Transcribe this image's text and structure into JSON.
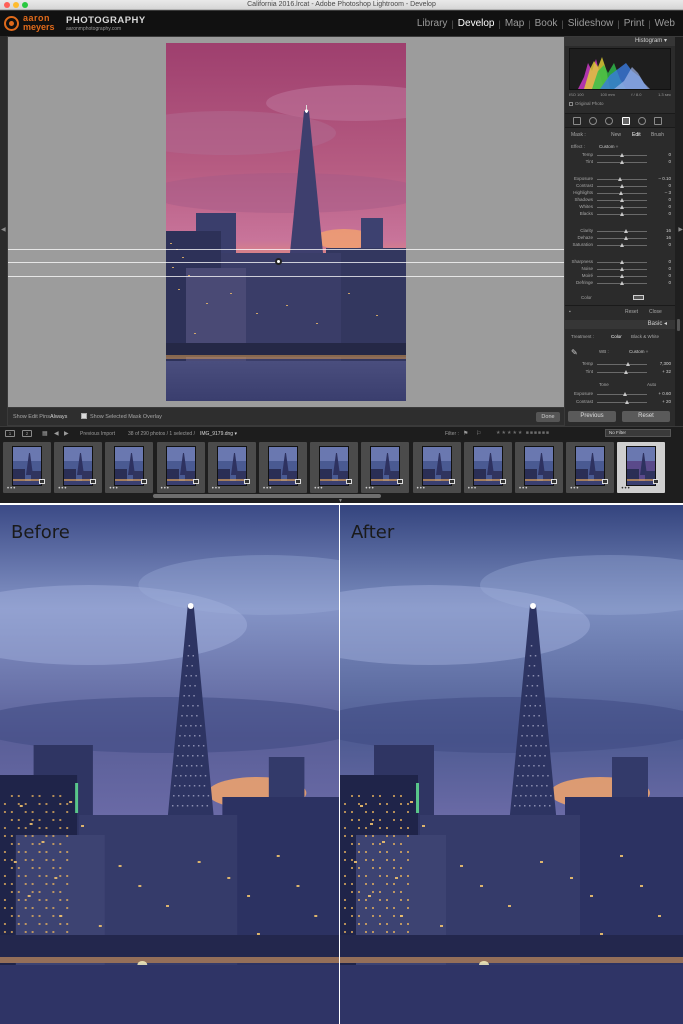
{
  "window": {
    "title": "California 2016.lrcat - Adobe Photoshop Lightroom - Develop",
    "traffic_lights": [
      "#ff5f57",
      "#febc2e",
      "#28c840"
    ]
  },
  "identity_plate": {
    "line1": "aaron",
    "line2": "meyers",
    "studio": "PHOTOGRAPHY",
    "url": "aaronmphotography.com",
    "accent_color": "#e06a1b"
  },
  "modules": [
    {
      "label": "Library",
      "active": false
    },
    {
      "label": "Develop",
      "active": true
    },
    {
      "label": "Map",
      "active": false
    },
    {
      "label": "Book",
      "active": false
    },
    {
      "label": "Slideshow",
      "active": false
    },
    {
      "label": "Print",
      "active": false
    },
    {
      "label": "Web",
      "active": false
    }
  ],
  "toolbar": {
    "show_edit_pins_label": "Show Edit Pins :",
    "show_edit_pins_value": "Always",
    "mask_overlay_label": "Show Selected Mask Overlay",
    "done_label": "Done"
  },
  "histogram": {
    "title": "Histogram",
    "iso": "ISO 100",
    "focal": "100 mm",
    "aperture": "f / 8.0",
    "shutter": "1.3 sec",
    "original_photo_label": "Original Photo"
  },
  "mask": {
    "label": "Mask :",
    "new_label": "New",
    "edit_label": "Edit",
    "brush_label": "Brush",
    "effect_label": "Effect :",
    "effect_value": "Custom ÷"
  },
  "local_sliders": [
    {
      "label": "Temp",
      "value": "0",
      "pos": 0.5
    },
    {
      "label": "Tint",
      "value": "0",
      "pos": 0.5
    },
    {
      "label": "Exposure",
      "value": "– 0.10",
      "pos": 0.46
    },
    {
      "label": "Contrast",
      "value": "0",
      "pos": 0.5
    },
    {
      "label": "Highlights",
      "value": "– 3",
      "pos": 0.48
    },
    {
      "label": "Shadows",
      "value": "0",
      "pos": 0.5
    },
    {
      "label": "Whites",
      "value": "0",
      "pos": 0.5
    },
    {
      "label": "Blacks",
      "value": "0",
      "pos": 0.5
    },
    {
      "label": "Clarity",
      "value": "16",
      "pos": 0.58
    },
    {
      "label": "Dehaze",
      "value": "16",
      "pos": 0.58
    },
    {
      "label": "Saturation",
      "value": "0",
      "pos": 0.5
    },
    {
      "label": "Sharpness",
      "value": "0",
      "pos": 0.5
    },
    {
      "label": "Noise",
      "value": "0",
      "pos": 0.5
    },
    {
      "label": "Moiré",
      "value": "0",
      "pos": 0.5
    },
    {
      "label": "Defringe",
      "value": "0",
      "pos": 0.5
    }
  ],
  "color_label": "Color",
  "reset_label": "Reset",
  "close_label": "Close",
  "basic": {
    "title": "Basic",
    "treatment_label": "Treatment :",
    "color_label": "Color",
    "bw_label": "Black & White",
    "wb_label": "WB :",
    "wb_value": "Custom ÷",
    "temp_label": "Temp",
    "temp_value": "7,300",
    "temp_pos": 0.62,
    "tint_label": "Tint",
    "tint_value": "+ 32",
    "tint_pos": 0.58,
    "tone_label": "Tone",
    "auto_label": "Auto",
    "exposure_label": "Exposure",
    "exposure_value": "+ 0.60",
    "exposure_pos": 0.56,
    "contrast_label": "Contrast",
    "contrast_value": "+ 20",
    "contrast_pos": 0.6
  },
  "panel_buttons": {
    "previous_label": "Previous",
    "reset_label": "Reset"
  },
  "filmbar": {
    "page1": "1",
    "page2": "2",
    "source": "Previous Import",
    "count_text": "38 of 290 photos / 1 selected /",
    "filename": "IMG_9179.dng ▾",
    "filter_label": "Filter :",
    "filter_value": "No Filter"
  },
  "filmstrip_count": 13,
  "comparison": {
    "before_label": "Before",
    "after_label": "After"
  }
}
